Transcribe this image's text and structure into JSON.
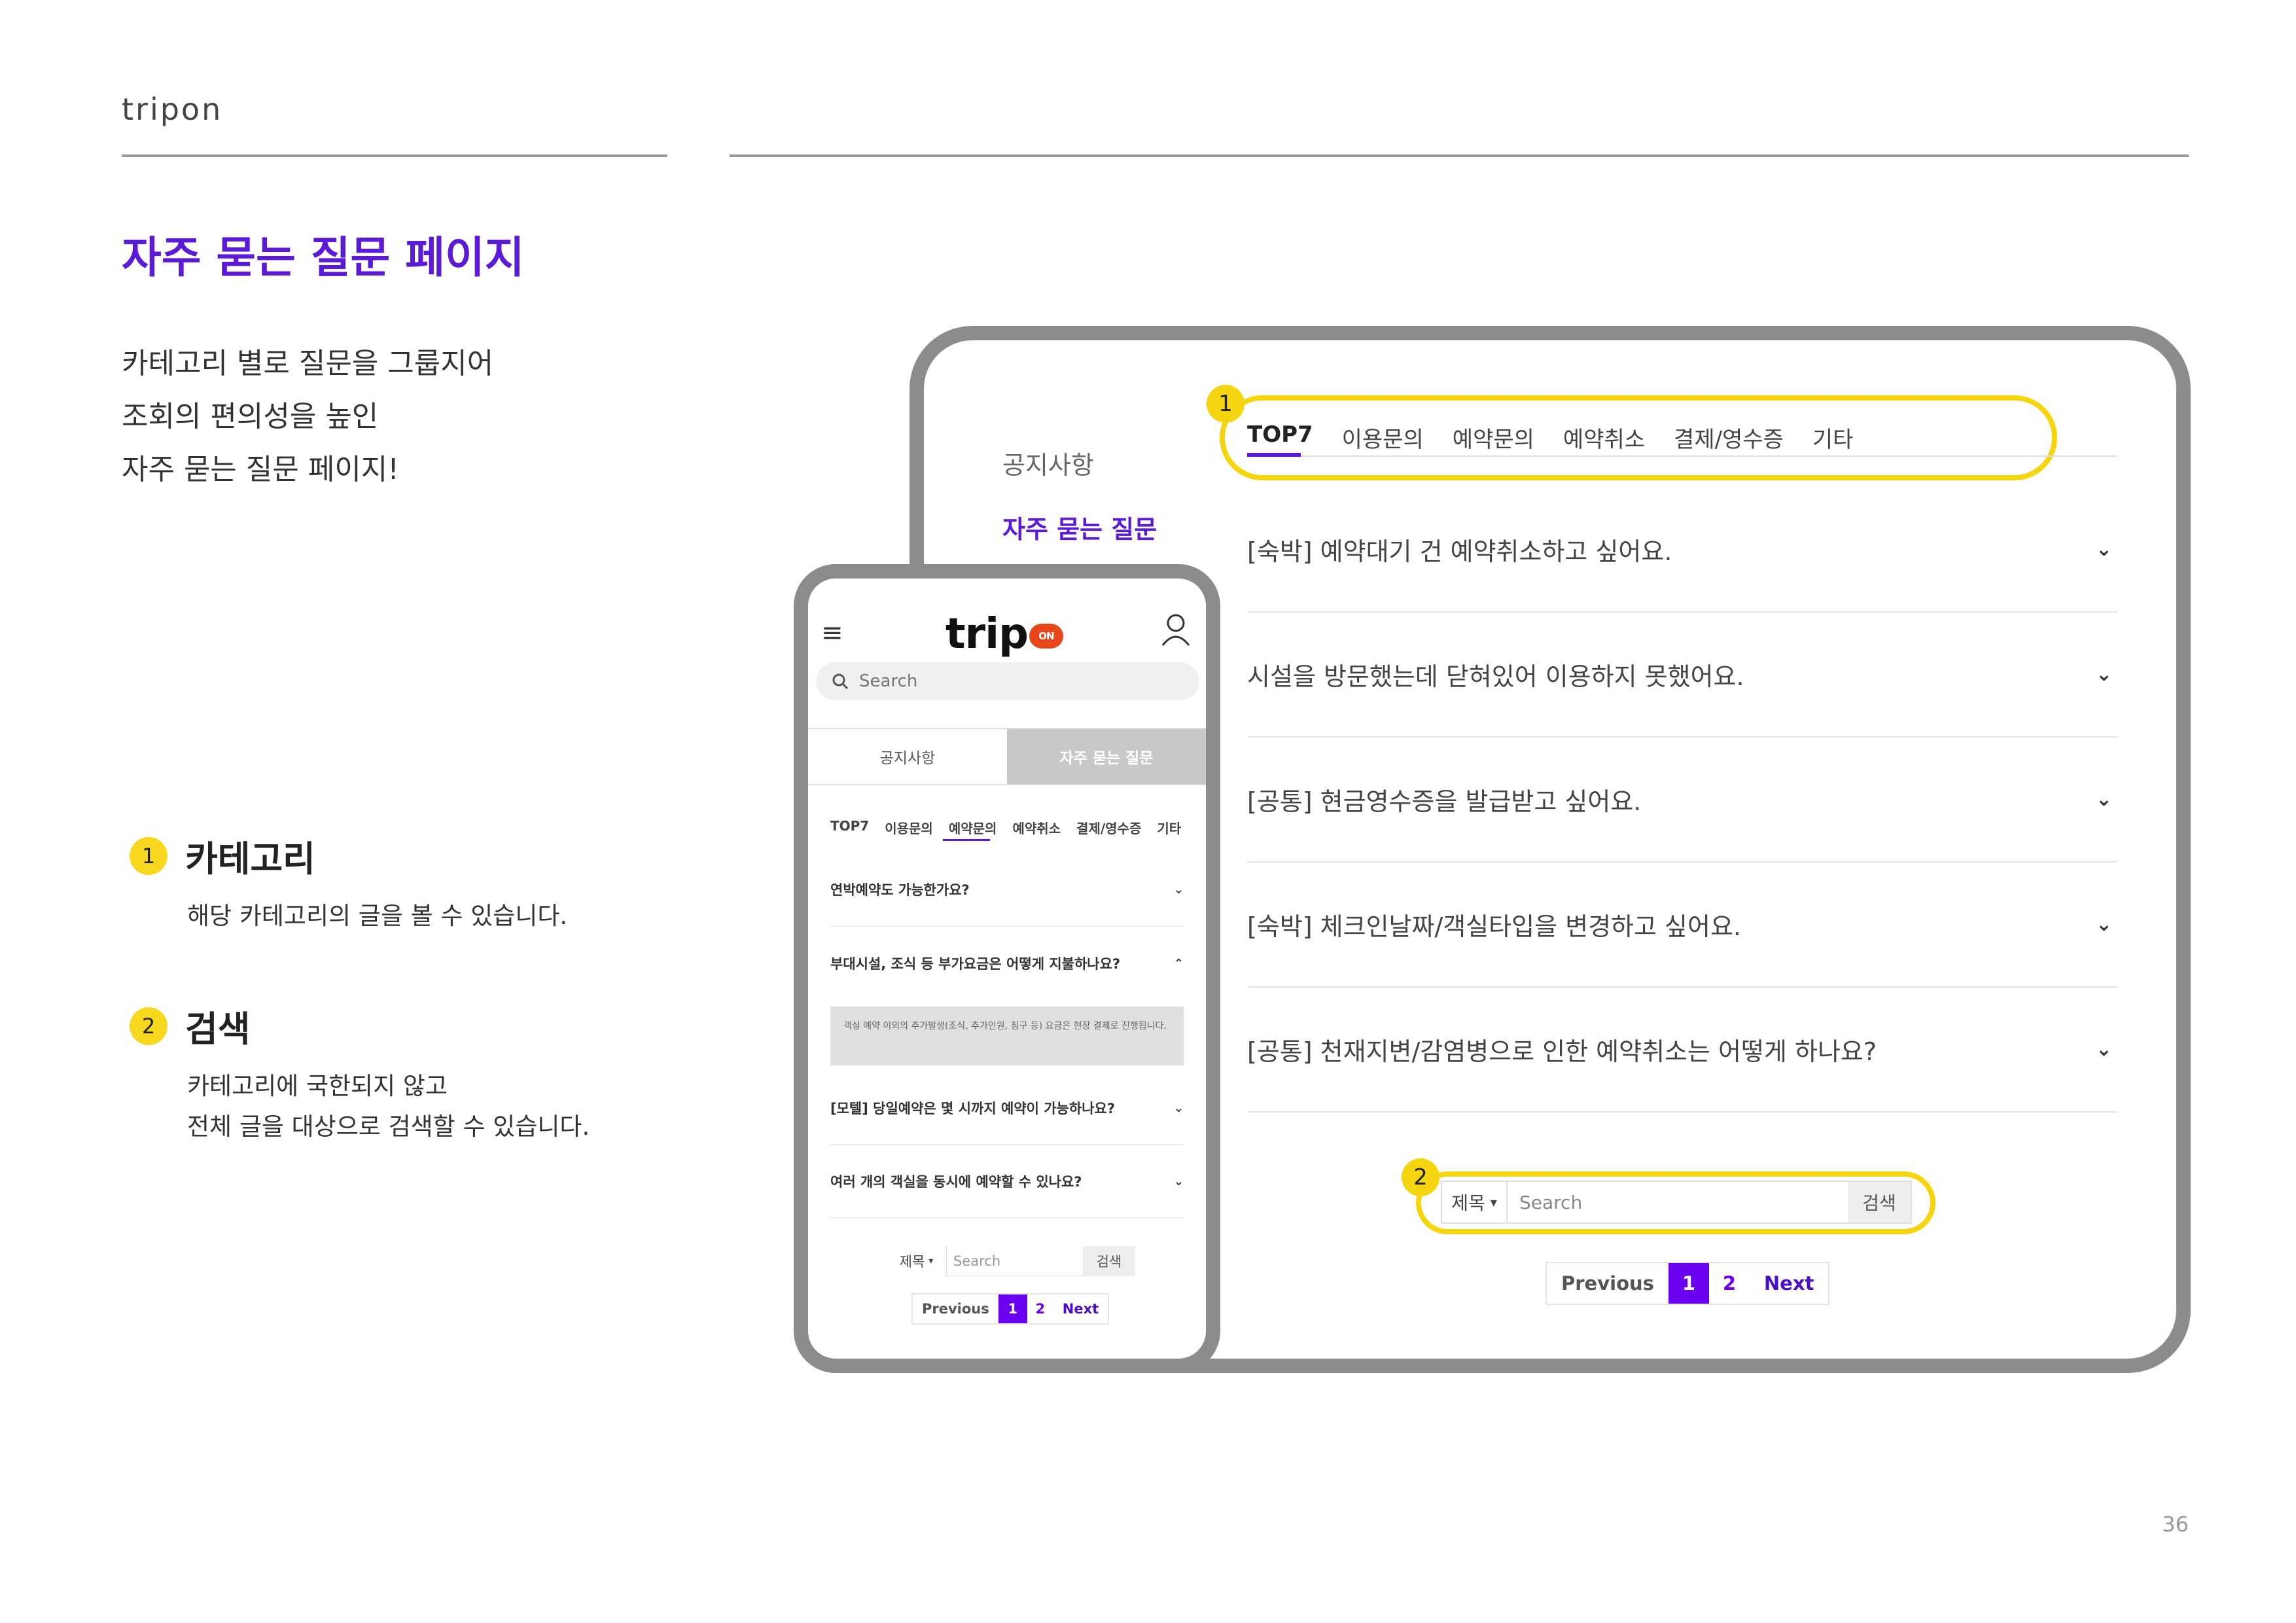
{
  "brand": "tripon",
  "page_title": "자주 묻는 질문 페이지",
  "intro": [
    "카테고리 별로 질문을 그룹지어",
    "조회의 편의성을 높인",
    "자주 묻는 질문 페이지!"
  ],
  "features": [
    {
      "number": "1",
      "title": "카테고리",
      "desc": [
        "해당 카테고리의 글을 볼 수 있습니다."
      ]
    },
    {
      "number": "2",
      "title": "검색",
      "desc": [
        "카테고리에 국한되지 않고",
        "전체 글을 대상으로 검색할 수 있습니다."
      ]
    }
  ],
  "page_number": "36",
  "desktop": {
    "sidebar": {
      "notice": "공지사항",
      "faq": "자주 묻는 질문"
    },
    "tabs": [
      "TOP7",
      "이용문의",
      "예약문의",
      "예약취소",
      "결제/영수증",
      "기타"
    ],
    "tab_badge": "1",
    "faq_items": [
      "[숙박] 예약대기 건 예약취소하고 싶어요.",
      "시설을 방문했는데 닫혀있어 이용하지 못했어요.",
      "[공통] 현금영수증을 발급받고 싶어요.",
      "[숙박] 체크인날짜/객실타입을 변경하고 싶어요.",
      "[공통] 천재지변/감염병으로 인한 예약취소는 어떻게 하나요?"
    ],
    "chevron": "⌄",
    "search": {
      "badge": "2",
      "select": "제목",
      "placeholder": "Search",
      "button": "검색"
    },
    "pager": {
      "prev": "Previous",
      "page1": "1",
      "page2": "2",
      "next": "Next"
    }
  },
  "mobile": {
    "logo": "trip",
    "logo_on": "ON",
    "search_placeholder": "Search",
    "subtabs": {
      "notice": "공지사항",
      "faq": "자주 묻는 질문"
    },
    "cats": [
      "TOP7",
      "이용문의",
      "예약문의",
      "예약취소",
      "결제/영수증",
      "기타"
    ],
    "items": [
      "연박예약도 가능한가요?",
      "부대시설, 조식 등 부가요금은 어떻게 지불하나요?",
      "[모텔] 당일예약은 몇 시까지 예약이 가능하나요?",
      "여러 개의 객실을 동시에 예약할 수 있나요?"
    ],
    "answer": "객실 예약 이외의 추가발생(조식, 추가인원, 침구 등) 요금은 현장 결제로 진행됩니다.",
    "search": {
      "select": "제목",
      "placeholder": "Search",
      "button": "검색"
    },
    "pager": {
      "prev": "Previous",
      "page1": "1",
      "page2": "2",
      "next": "Next"
    }
  },
  "colors": {
    "accent": "#5a1ad6",
    "highlight": "#f5d50f",
    "page_active": "#6a00f0",
    "frame": "#8c8c8c"
  }
}
